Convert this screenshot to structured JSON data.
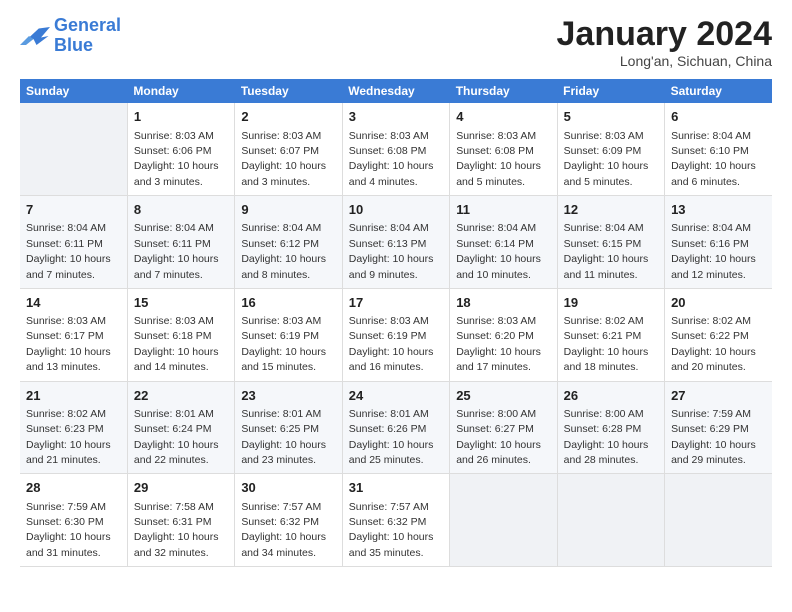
{
  "logo": {
    "line1": "General",
    "line2": "Blue"
  },
  "title": "January 2024",
  "location": "Long'an, Sichuan, China",
  "weekdays": [
    "Sunday",
    "Monday",
    "Tuesday",
    "Wednesday",
    "Thursday",
    "Friday",
    "Saturday"
  ],
  "weeks": [
    [
      {
        "day": "",
        "sunrise": "",
        "sunset": "",
        "daylight": ""
      },
      {
        "day": "1",
        "sunrise": "Sunrise: 8:03 AM",
        "sunset": "Sunset: 6:06 PM",
        "daylight": "Daylight: 10 hours and 3 minutes."
      },
      {
        "day": "2",
        "sunrise": "Sunrise: 8:03 AM",
        "sunset": "Sunset: 6:07 PM",
        "daylight": "Daylight: 10 hours and 3 minutes."
      },
      {
        "day": "3",
        "sunrise": "Sunrise: 8:03 AM",
        "sunset": "Sunset: 6:08 PM",
        "daylight": "Daylight: 10 hours and 4 minutes."
      },
      {
        "day": "4",
        "sunrise": "Sunrise: 8:03 AM",
        "sunset": "Sunset: 6:08 PM",
        "daylight": "Daylight: 10 hours and 5 minutes."
      },
      {
        "day": "5",
        "sunrise": "Sunrise: 8:03 AM",
        "sunset": "Sunset: 6:09 PM",
        "daylight": "Daylight: 10 hours and 5 minutes."
      },
      {
        "day": "6",
        "sunrise": "Sunrise: 8:04 AM",
        "sunset": "Sunset: 6:10 PM",
        "daylight": "Daylight: 10 hours and 6 minutes."
      }
    ],
    [
      {
        "day": "7",
        "sunrise": "Sunrise: 8:04 AM",
        "sunset": "Sunset: 6:11 PM",
        "daylight": "Daylight: 10 hours and 7 minutes."
      },
      {
        "day": "8",
        "sunrise": "Sunrise: 8:04 AM",
        "sunset": "Sunset: 6:11 PM",
        "daylight": "Daylight: 10 hours and 7 minutes."
      },
      {
        "day": "9",
        "sunrise": "Sunrise: 8:04 AM",
        "sunset": "Sunset: 6:12 PM",
        "daylight": "Daylight: 10 hours and 8 minutes."
      },
      {
        "day": "10",
        "sunrise": "Sunrise: 8:04 AM",
        "sunset": "Sunset: 6:13 PM",
        "daylight": "Daylight: 10 hours and 9 minutes."
      },
      {
        "day": "11",
        "sunrise": "Sunrise: 8:04 AM",
        "sunset": "Sunset: 6:14 PM",
        "daylight": "Daylight: 10 hours and 10 minutes."
      },
      {
        "day": "12",
        "sunrise": "Sunrise: 8:04 AM",
        "sunset": "Sunset: 6:15 PM",
        "daylight": "Daylight: 10 hours and 11 minutes."
      },
      {
        "day": "13",
        "sunrise": "Sunrise: 8:04 AM",
        "sunset": "Sunset: 6:16 PM",
        "daylight": "Daylight: 10 hours and 12 minutes."
      }
    ],
    [
      {
        "day": "14",
        "sunrise": "Sunrise: 8:03 AM",
        "sunset": "Sunset: 6:17 PM",
        "daylight": "Daylight: 10 hours and 13 minutes."
      },
      {
        "day": "15",
        "sunrise": "Sunrise: 8:03 AM",
        "sunset": "Sunset: 6:18 PM",
        "daylight": "Daylight: 10 hours and 14 minutes."
      },
      {
        "day": "16",
        "sunrise": "Sunrise: 8:03 AM",
        "sunset": "Sunset: 6:19 PM",
        "daylight": "Daylight: 10 hours and 15 minutes."
      },
      {
        "day": "17",
        "sunrise": "Sunrise: 8:03 AM",
        "sunset": "Sunset: 6:19 PM",
        "daylight": "Daylight: 10 hours and 16 minutes."
      },
      {
        "day": "18",
        "sunrise": "Sunrise: 8:03 AM",
        "sunset": "Sunset: 6:20 PM",
        "daylight": "Daylight: 10 hours and 17 minutes."
      },
      {
        "day": "19",
        "sunrise": "Sunrise: 8:02 AM",
        "sunset": "Sunset: 6:21 PM",
        "daylight": "Daylight: 10 hours and 18 minutes."
      },
      {
        "day": "20",
        "sunrise": "Sunrise: 8:02 AM",
        "sunset": "Sunset: 6:22 PM",
        "daylight": "Daylight: 10 hours and 20 minutes."
      }
    ],
    [
      {
        "day": "21",
        "sunrise": "Sunrise: 8:02 AM",
        "sunset": "Sunset: 6:23 PM",
        "daylight": "Daylight: 10 hours and 21 minutes."
      },
      {
        "day": "22",
        "sunrise": "Sunrise: 8:01 AM",
        "sunset": "Sunset: 6:24 PM",
        "daylight": "Daylight: 10 hours and 22 minutes."
      },
      {
        "day": "23",
        "sunrise": "Sunrise: 8:01 AM",
        "sunset": "Sunset: 6:25 PM",
        "daylight": "Daylight: 10 hours and 23 minutes."
      },
      {
        "day": "24",
        "sunrise": "Sunrise: 8:01 AM",
        "sunset": "Sunset: 6:26 PM",
        "daylight": "Daylight: 10 hours and 25 minutes."
      },
      {
        "day": "25",
        "sunrise": "Sunrise: 8:00 AM",
        "sunset": "Sunset: 6:27 PM",
        "daylight": "Daylight: 10 hours and 26 minutes."
      },
      {
        "day": "26",
        "sunrise": "Sunrise: 8:00 AM",
        "sunset": "Sunset: 6:28 PM",
        "daylight": "Daylight: 10 hours and 28 minutes."
      },
      {
        "day": "27",
        "sunrise": "Sunrise: 7:59 AM",
        "sunset": "Sunset: 6:29 PM",
        "daylight": "Daylight: 10 hours and 29 minutes."
      }
    ],
    [
      {
        "day": "28",
        "sunrise": "Sunrise: 7:59 AM",
        "sunset": "Sunset: 6:30 PM",
        "daylight": "Daylight: 10 hours and 31 minutes."
      },
      {
        "day": "29",
        "sunrise": "Sunrise: 7:58 AM",
        "sunset": "Sunset: 6:31 PM",
        "daylight": "Daylight: 10 hours and 32 minutes."
      },
      {
        "day": "30",
        "sunrise": "Sunrise: 7:57 AM",
        "sunset": "Sunset: 6:32 PM",
        "daylight": "Daylight: 10 hours and 34 minutes."
      },
      {
        "day": "31",
        "sunrise": "Sunrise: 7:57 AM",
        "sunset": "Sunset: 6:32 PM",
        "daylight": "Daylight: 10 hours and 35 minutes."
      },
      {
        "day": "",
        "sunrise": "",
        "sunset": "",
        "daylight": ""
      },
      {
        "day": "",
        "sunrise": "",
        "sunset": "",
        "daylight": ""
      },
      {
        "day": "",
        "sunrise": "",
        "sunset": "",
        "daylight": ""
      }
    ]
  ]
}
